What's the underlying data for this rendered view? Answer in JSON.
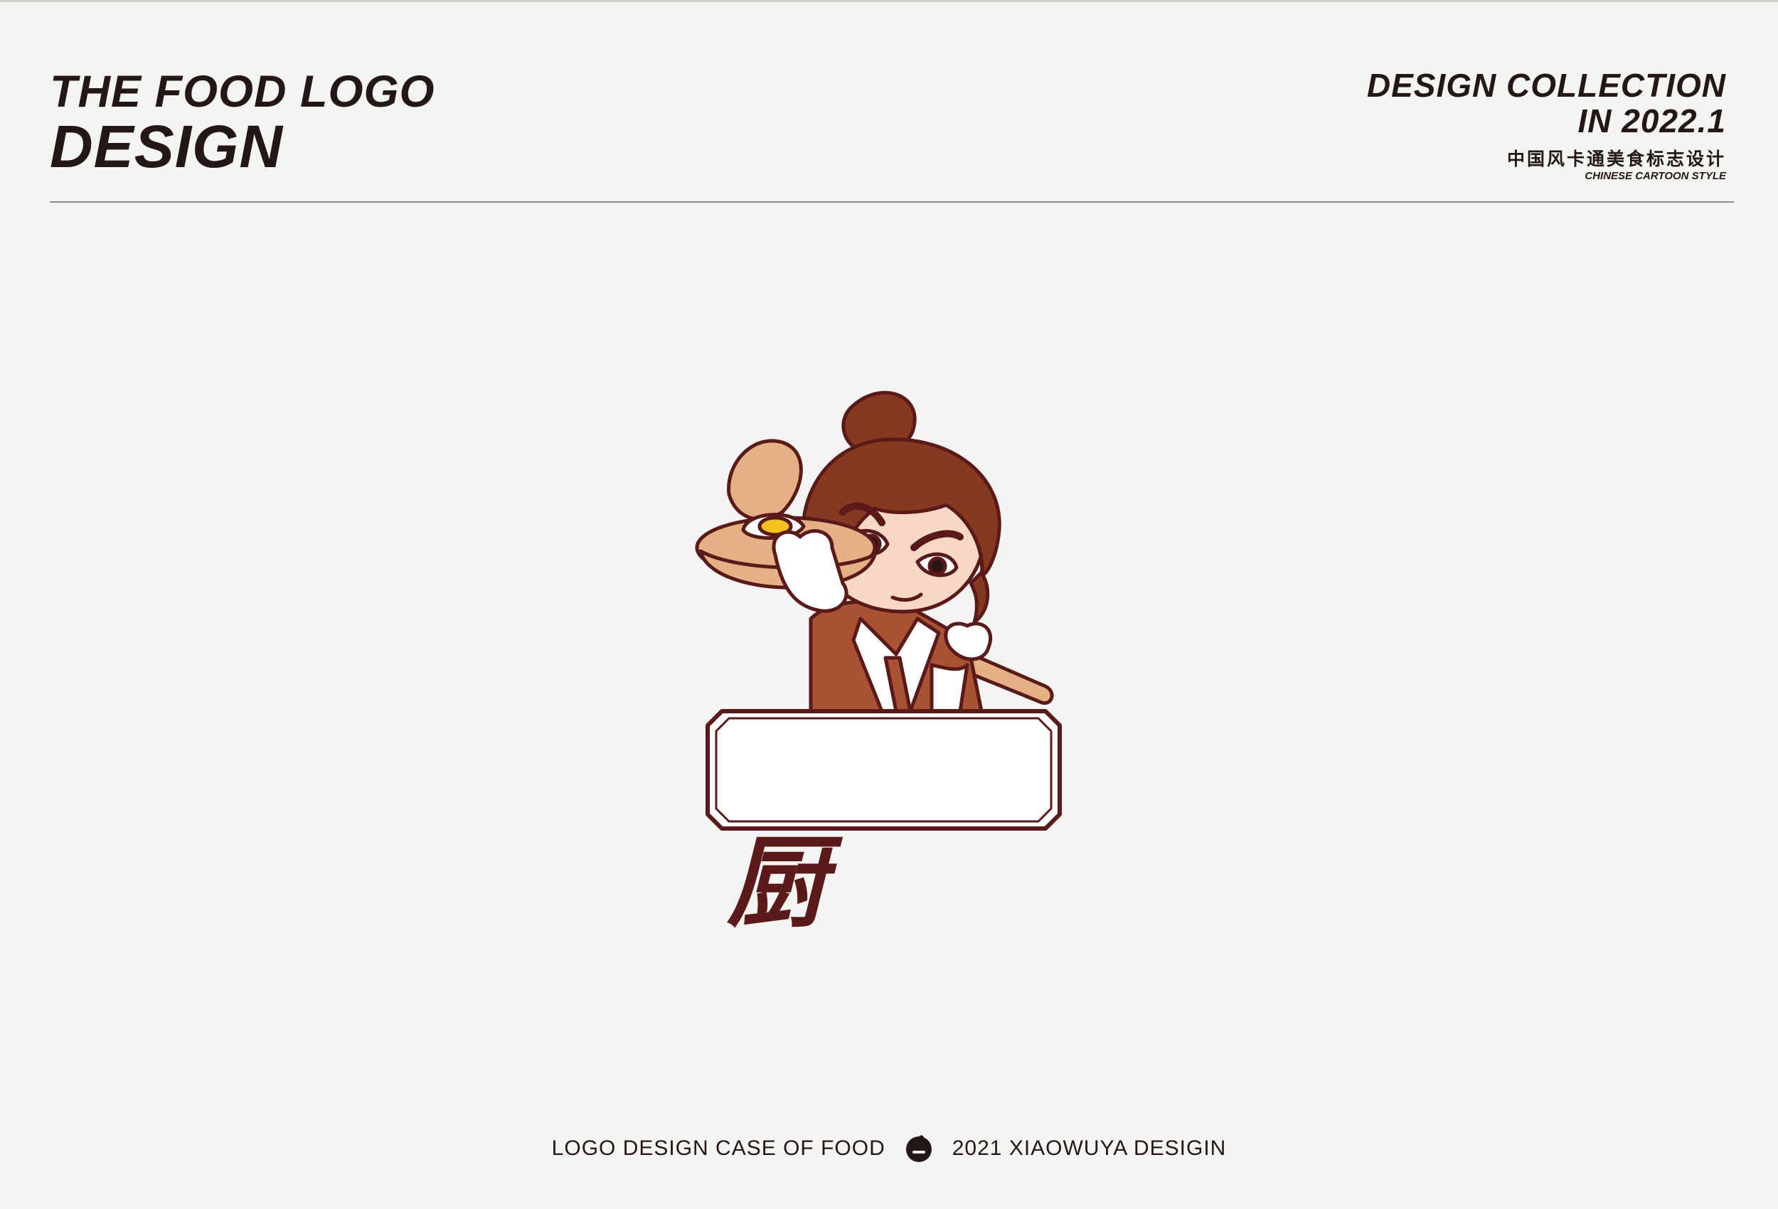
{
  "header": {
    "title_line1": "THE FOOD LOGO",
    "title_line2": "DESIGN",
    "collection_line1": "DESIGN COLLECTION",
    "collection_line2": "IN 2022.1",
    "subtitle_cn": "中国风卡通美食标志设计",
    "subtitle_en": "CHINESE CARTOON STYLE"
  },
  "logo": {
    "character_glyph": "厨",
    "colors": {
      "outline": "#5a1a1a",
      "hair": "#86391f",
      "skin": "#f6d8c4",
      "robe": "#a95234",
      "tray": "#e3b184",
      "yolk": "#f5c21b"
    }
  },
  "footer": {
    "left_text": "LOGO DESIGN CASE OF FOOD",
    "right_text": "2021 XIAOWUYA DESIGIN",
    "mark_icon": "crow-head-icon"
  }
}
